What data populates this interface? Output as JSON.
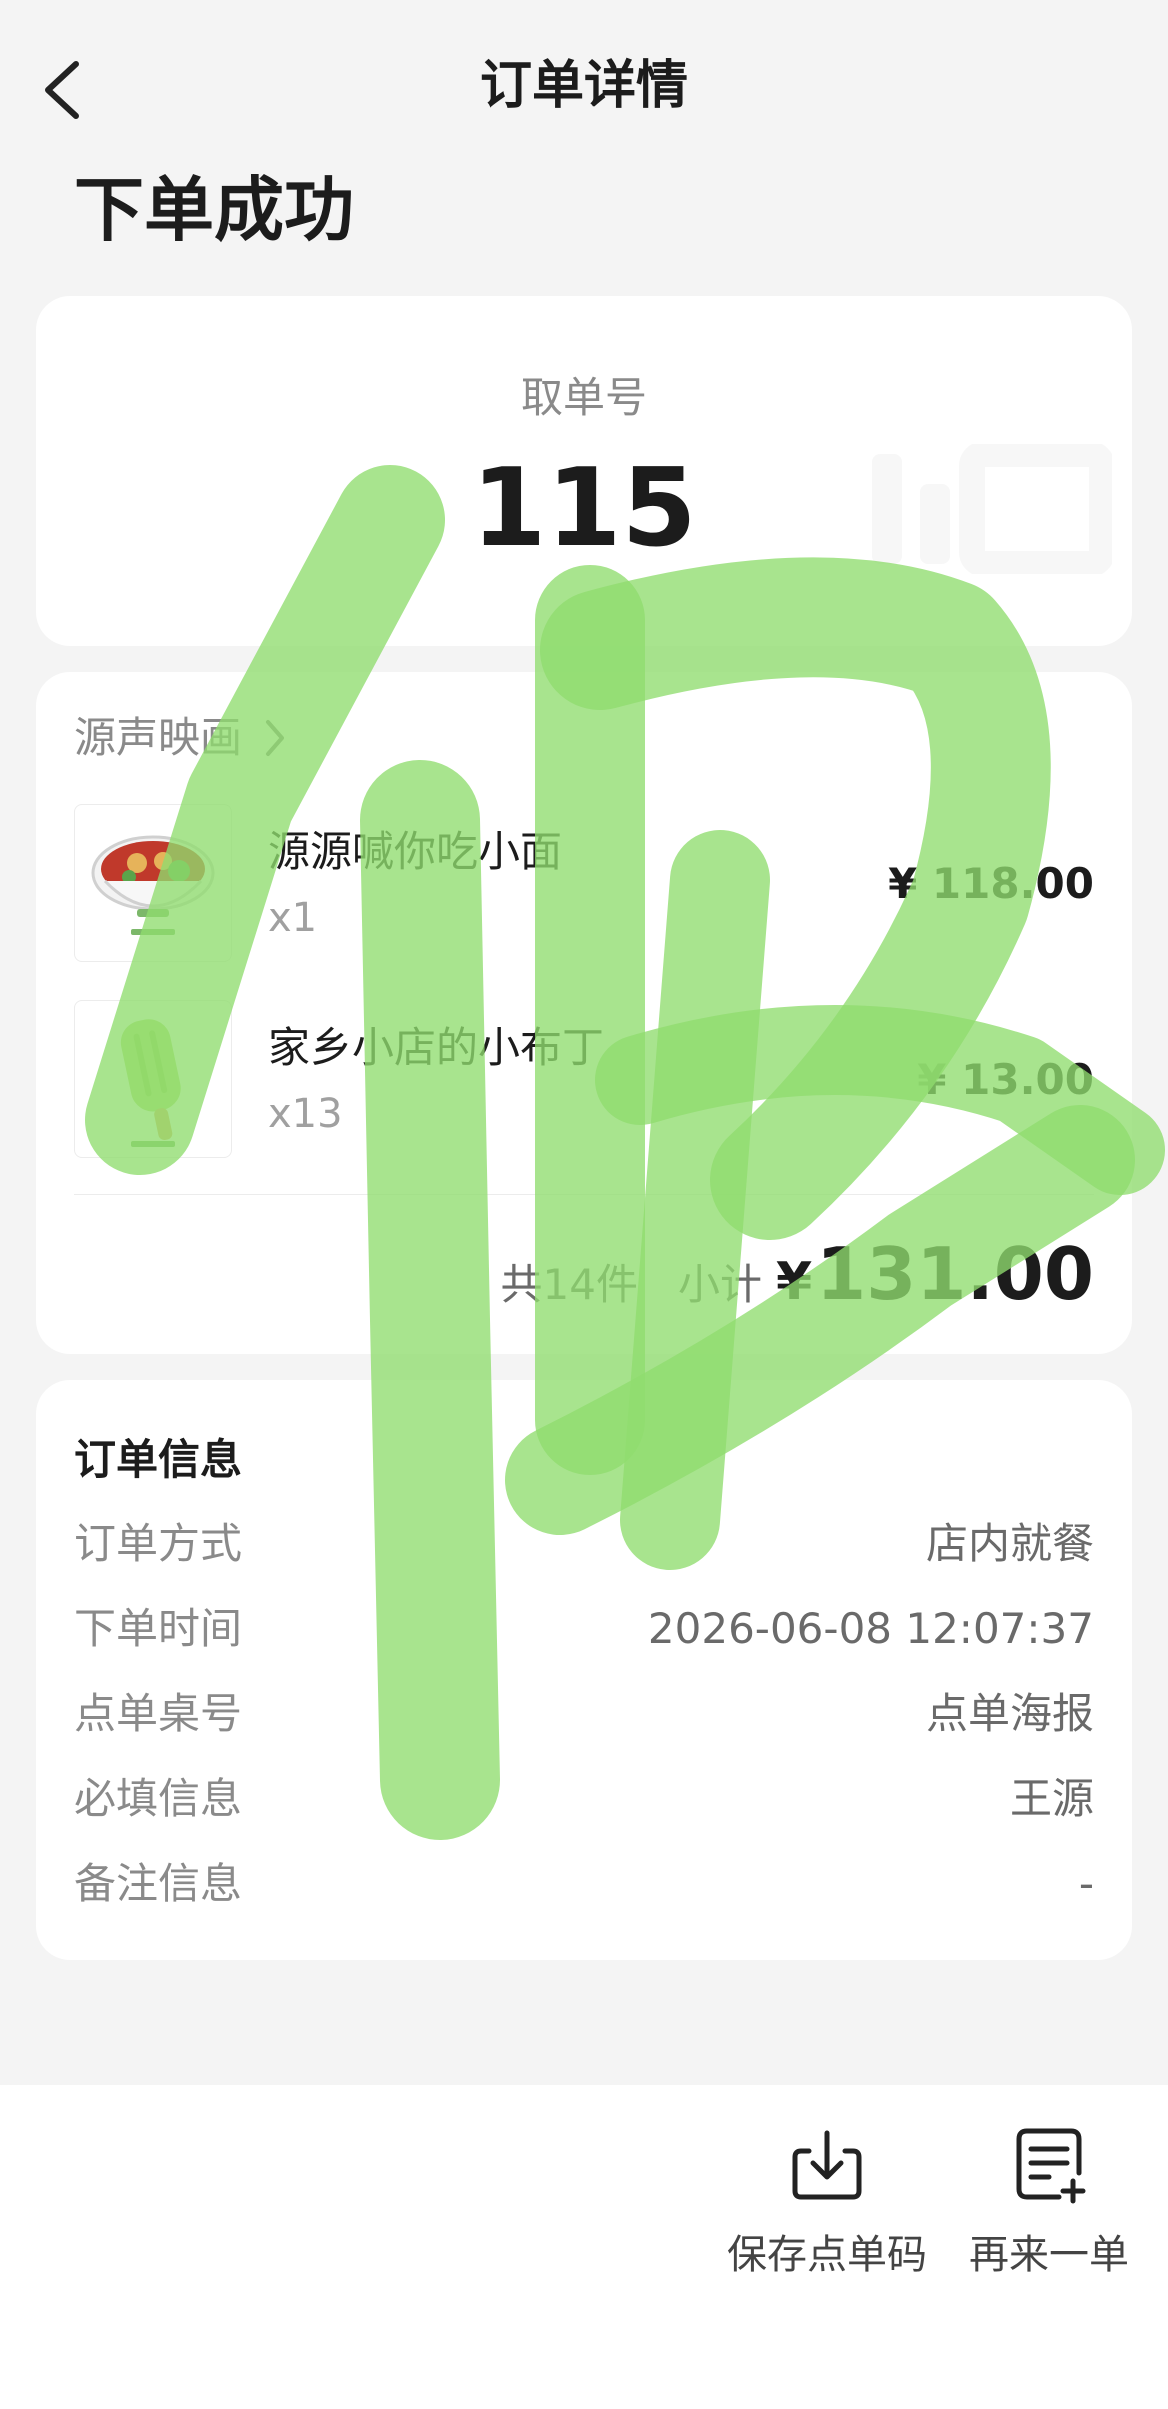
{
  "header": {
    "title": "订单详情",
    "back_icon": "chevron-left-icon"
  },
  "status": {
    "title": "下单成功"
  },
  "pickup": {
    "label": "取单号",
    "number": "115"
  },
  "store": {
    "name": "源声映画",
    "arrow_icon": "chevron-right-icon"
  },
  "items": [
    {
      "name": "源源喊你吃小面",
      "qty": "x1",
      "price": "¥ 118.00",
      "image_icon": "noodle-bowl-image"
    },
    {
      "name": "家乡小店的小布丁",
      "qty": "x13",
      "price": "¥ 13.00",
      "image_icon": "popsicle-image"
    }
  ],
  "summary": {
    "count": "共14件",
    "subtotal_label": "小计",
    "currency": "¥",
    "total": "131.00"
  },
  "order_info": {
    "heading": "订单信息",
    "rows": [
      {
        "label": "订单方式",
        "value": "店内就餐"
      },
      {
        "label": "下单时间",
        "value": "2026-06-08 12:07:37"
      },
      {
        "label": "点单桌号",
        "value": "点单海报"
      },
      {
        "label": "必填信息",
        "value": "王源"
      },
      {
        "label": "备注信息",
        "value": "-"
      }
    ]
  },
  "actions": [
    {
      "label": "保存点单码",
      "icon": "download-tray-icon"
    },
    {
      "label": "再来一单",
      "icon": "document-add-icon"
    }
  ],
  "colors": {
    "watermark": "#8fdc6e",
    "accent_text": "#1c1c1c",
    "background": "#f4f4f4"
  }
}
